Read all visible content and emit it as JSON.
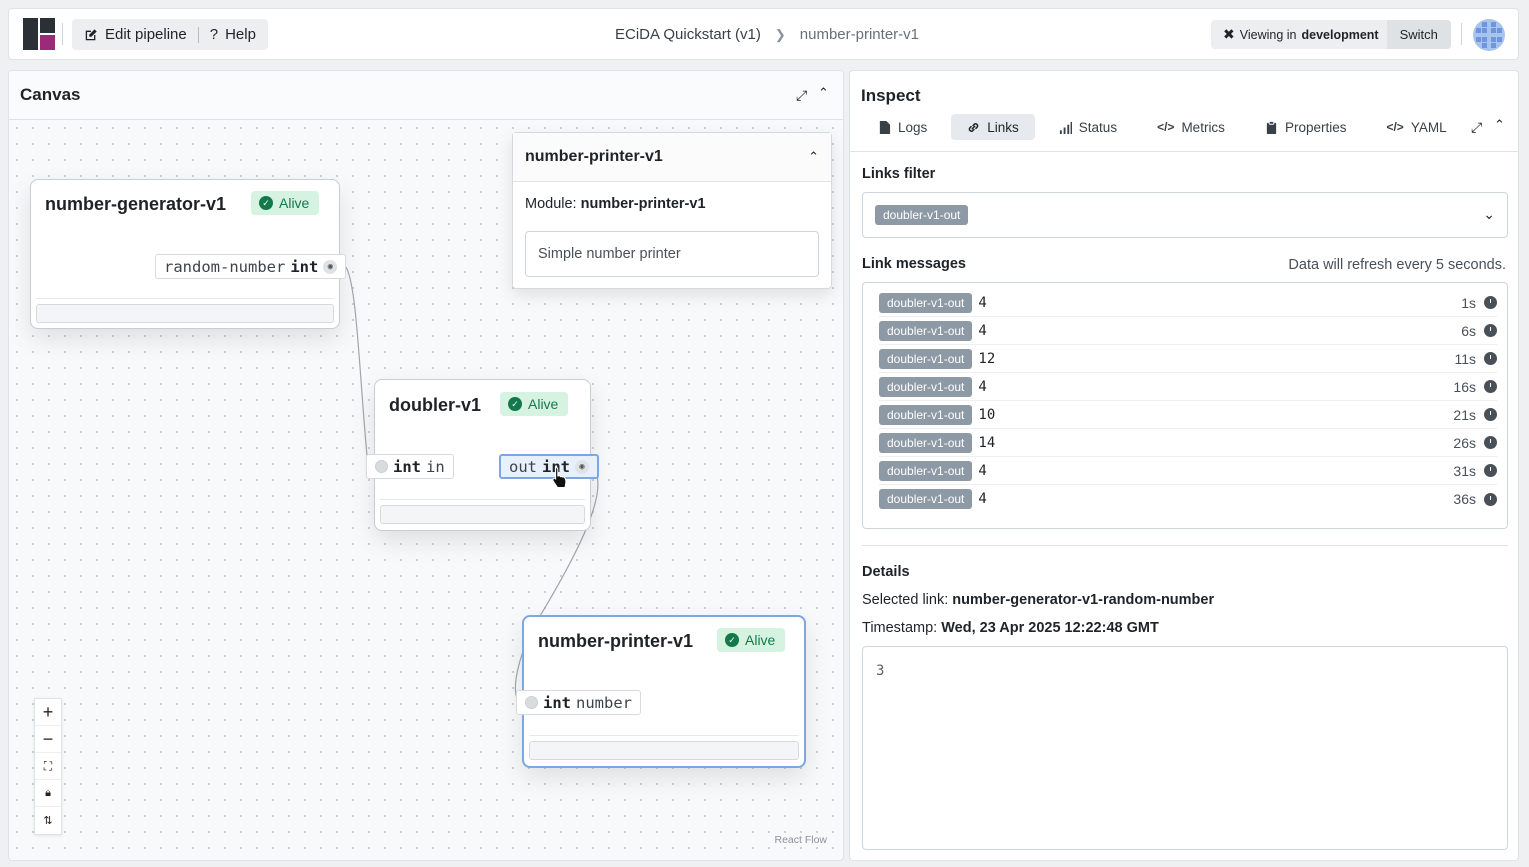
{
  "header": {
    "edit_label": "Edit pipeline",
    "help_label": "Help",
    "breadcrumb": [
      "ECiDA Quickstart (v1)",
      "number-printer-v1"
    ],
    "env_prefix": "Viewing in",
    "env_name": "development",
    "switch_label": "Switch"
  },
  "canvas": {
    "title": "Canvas",
    "attribution": "React Flow",
    "nodes": [
      {
        "name": "number-generator-v1",
        "status": "Alive",
        "ports": [
          {
            "direction": "out",
            "name": "random-number",
            "type": "int"
          }
        ]
      },
      {
        "name": "doubler-v1",
        "status": "Alive",
        "ports": [
          {
            "direction": "in",
            "type": "int",
            "name": "in"
          },
          {
            "direction": "out",
            "name": "out",
            "type": "int"
          }
        ]
      },
      {
        "name": "number-printer-v1",
        "status": "Alive",
        "ports": [
          {
            "direction": "in",
            "type": "int",
            "name": "number"
          }
        ]
      }
    ],
    "popup": {
      "title": "number-printer-v1",
      "module_label": "Module:",
      "module_name": "number-printer-v1",
      "description": "Simple number printer"
    }
  },
  "inspect": {
    "title": "Inspect",
    "tabs": [
      "Logs",
      "Links",
      "Status",
      "Metrics",
      "Properties",
      "YAML"
    ],
    "active_tab": "Links",
    "links_filter_label": "Links filter",
    "filter_tag": "doubler-v1-out",
    "link_messages_label": "Link messages",
    "refresh_note": "Data will refresh every 5 seconds.",
    "messages": [
      {
        "link": "doubler-v1-out",
        "value": "4",
        "age": "1s"
      },
      {
        "link": "doubler-v1-out",
        "value": "4",
        "age": "6s"
      },
      {
        "link": "doubler-v1-out",
        "value": "12",
        "age": "11s"
      },
      {
        "link": "doubler-v1-out",
        "value": "4",
        "age": "16s"
      },
      {
        "link": "doubler-v1-out",
        "value": "10",
        "age": "21s"
      },
      {
        "link": "doubler-v1-out",
        "value": "14",
        "age": "26s"
      },
      {
        "link": "doubler-v1-out",
        "value": "4",
        "age": "31s"
      },
      {
        "link": "doubler-v1-out",
        "value": "4",
        "age": "36s"
      }
    ],
    "details_label": "Details",
    "selected_link_label": "Selected link:",
    "selected_link": "number-generator-v1-random-number",
    "timestamp_label": "Timestamp:",
    "timestamp": "Wed, 23 Apr 2025 12:22:48 GMT",
    "payload": "3"
  },
  "colors": {
    "alive_bg": "#d5f3e0",
    "alive_fg": "#13794a",
    "tag_bg": "#8e99a6",
    "selection_border": "#7ea6e0",
    "logo_dark": "#2b2f36",
    "logo_accent": "#9b2a7a"
  }
}
